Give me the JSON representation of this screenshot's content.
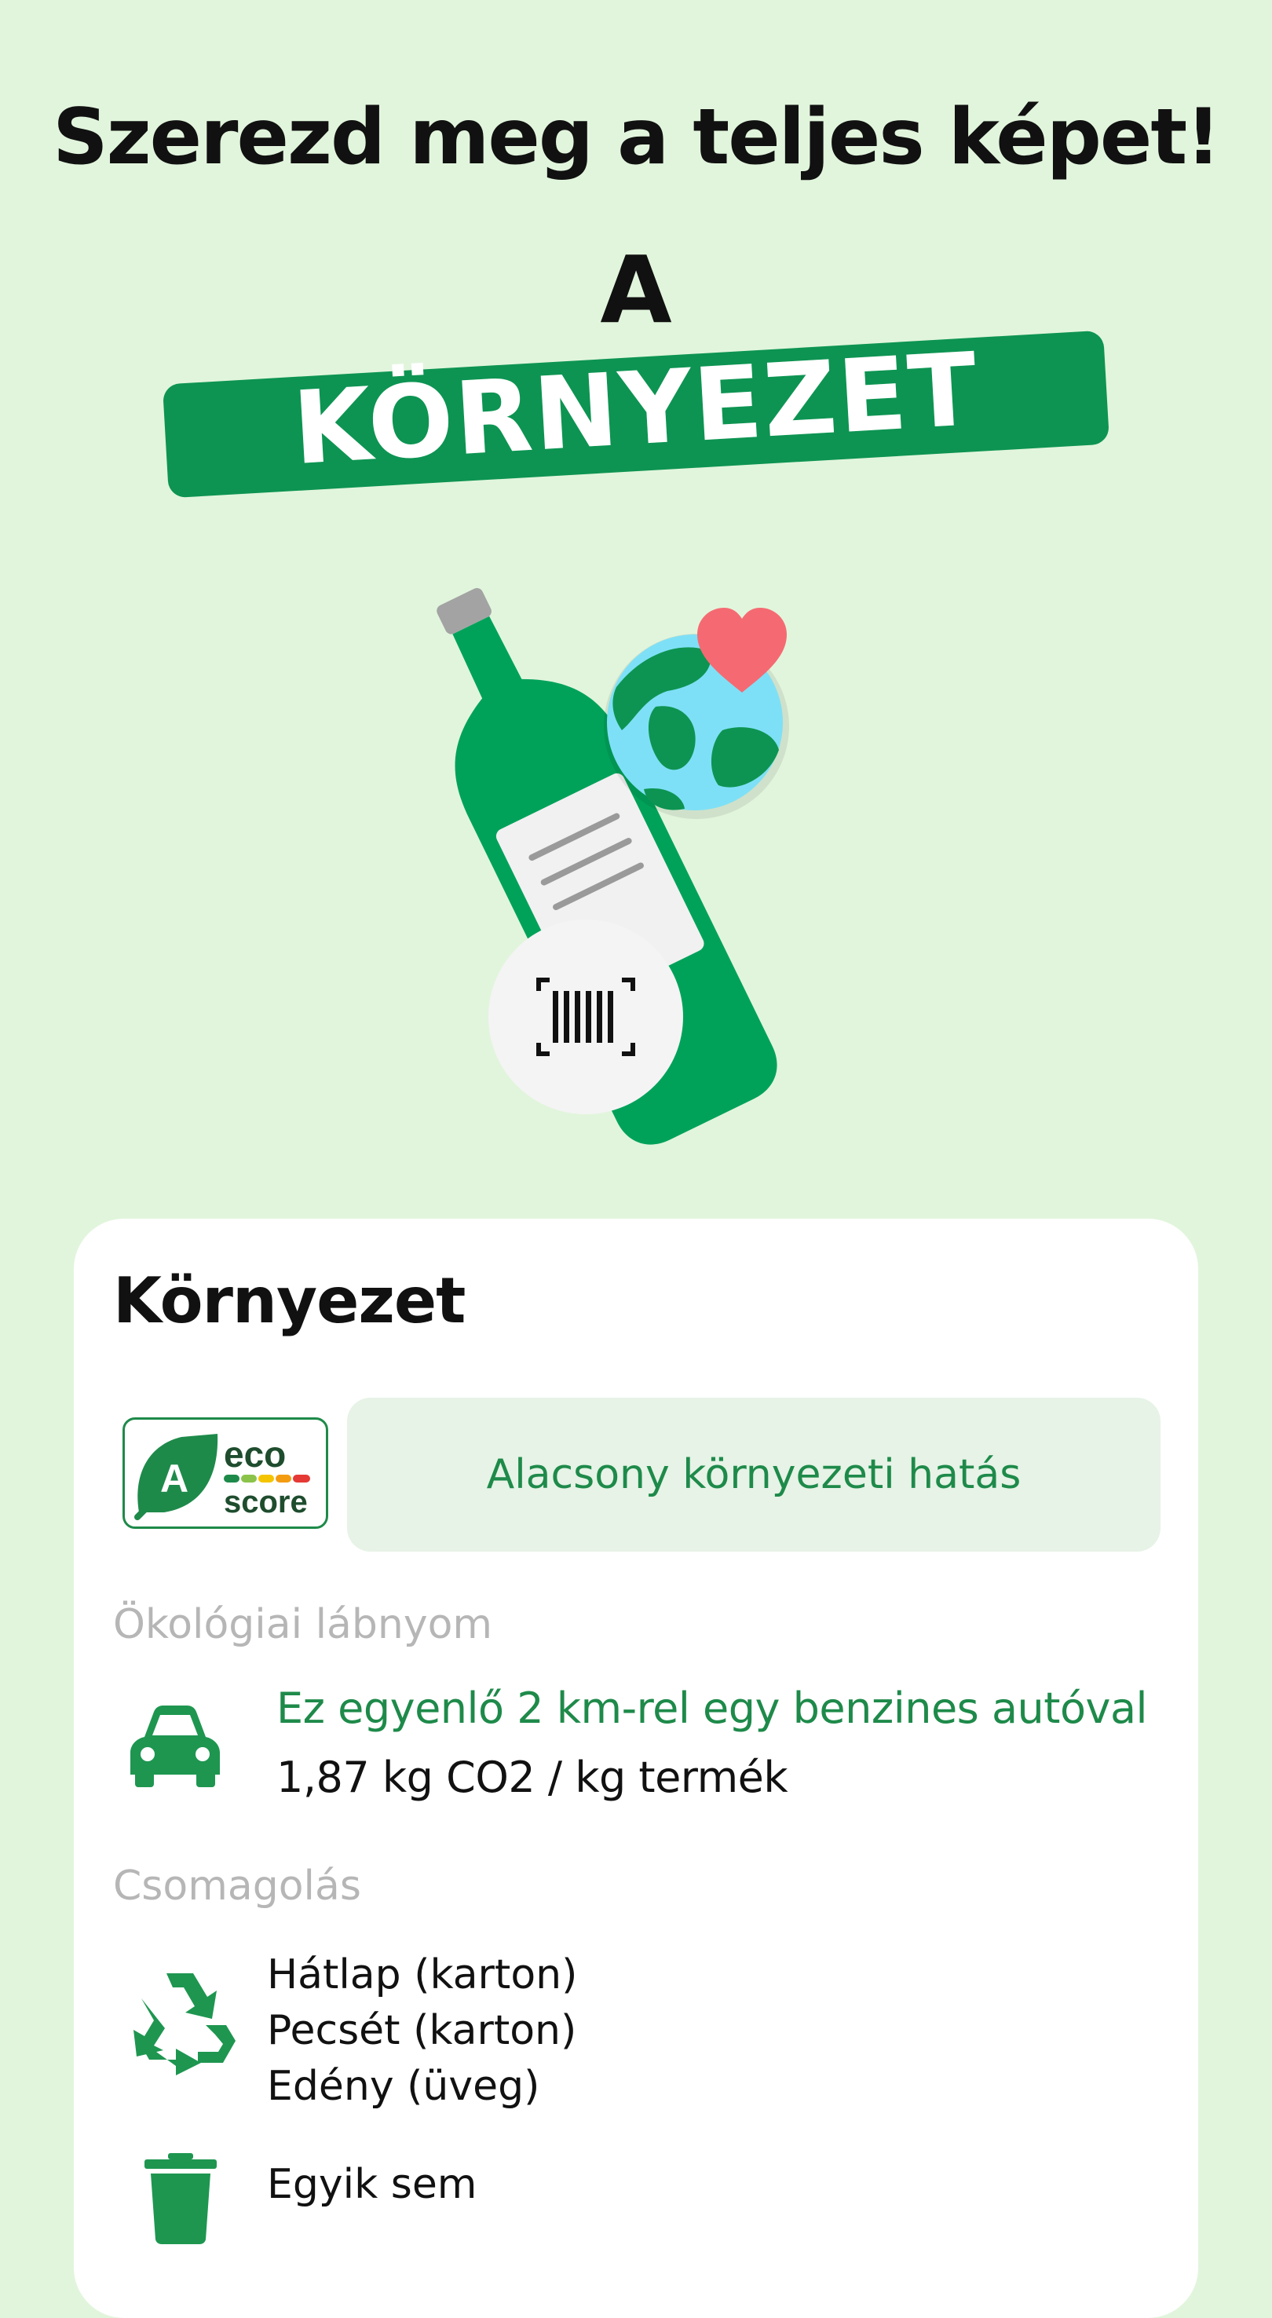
{
  "header": {
    "headline": "Szerezd meg a teljes képet!",
    "letter": "A",
    "banner": "KÖRNYEZET"
  },
  "illustration": {
    "icons": [
      "bottle-icon",
      "globe-icon",
      "heart-icon",
      "barcode-scan-icon"
    ],
    "colors": {
      "bottle": "#00a25a",
      "cap": "#a3a3a3",
      "globe_water": "#7ee0f6",
      "globe_land": "#0d9452",
      "heart": "#f56a72"
    }
  },
  "card": {
    "title": "Környezet",
    "ecoscore": {
      "grade": "A",
      "logo_word_top": "eco",
      "logo_word_bottom": "score",
      "impact_text": "Alacsony környezeti hatás",
      "accent": "#1e8a4a"
    },
    "footprint": {
      "label": "Ökológiai lábnyom",
      "equivalence": "Ez egyenlő 2 km-rel egy benzines autóval",
      "value": "1,87 kg CO2 / kg termék",
      "icon": "car-icon"
    },
    "packaging": {
      "label": "Csomagolás",
      "icon": "recycle-icon",
      "items": [
        "Hátlap (karton)",
        "Pecsét (karton)",
        "Edény (üveg)"
      ],
      "non_recyclable_icon": "trash-icon",
      "non_recyclable": "Egyik sem"
    }
  }
}
